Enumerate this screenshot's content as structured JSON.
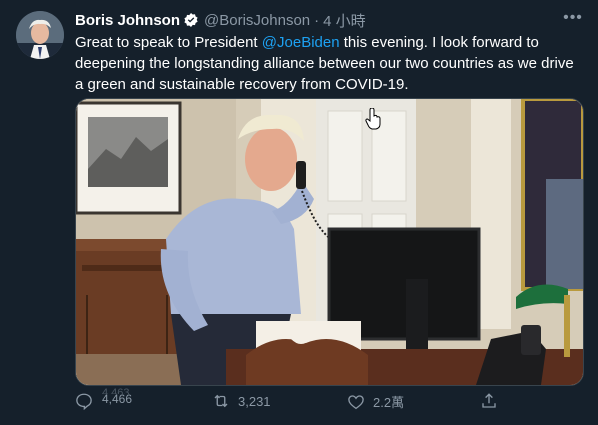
{
  "tweet": {
    "name": "Boris Johnson",
    "handle": "@BorisJohnson",
    "separator": "·",
    "time": "4 小時",
    "more_label": "•••",
    "text_before": "Great to speak to President ",
    "mention": "@JoeBiden",
    "text_after": " this evening. I look forward to deepening the longstanding alliance between our two countries as we drive a green and sustainable recovery from COVID-19."
  },
  "actions": {
    "reply_count_partial": "4,463",
    "reply_count": "4,466",
    "retweet_count": "3,231",
    "like_count": "2.2萬"
  },
  "colors": {
    "background": "#15202b",
    "accent": "#1da1f2",
    "secondary_text": "#8b98a5"
  },
  "icons": [
    "verified-badge-icon",
    "more-options-icon",
    "reply-icon",
    "retweet-icon",
    "like-icon",
    "share-icon",
    "mouse-cursor-icon"
  ]
}
